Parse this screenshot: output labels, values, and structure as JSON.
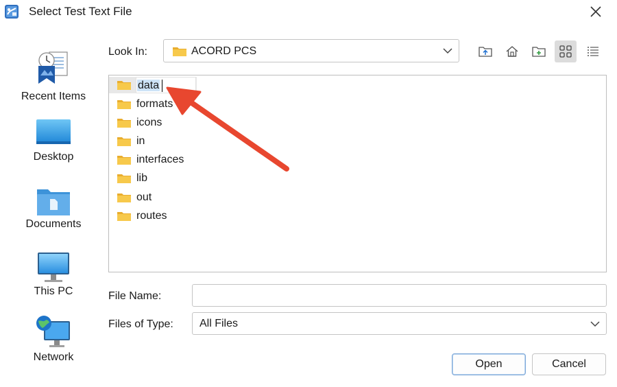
{
  "window": {
    "title": "Select Test Text File"
  },
  "colors": {
    "accent": "#1f6fd0",
    "selection": "#cde3f7",
    "folder": "#f5c342",
    "arrow": "#e8472f"
  },
  "places": [
    {
      "label": "Recent Items",
      "icon": "recent-items-icon"
    },
    {
      "label": "Desktop",
      "icon": "desktop-icon"
    },
    {
      "label": "Documents",
      "icon": "documents-icon"
    },
    {
      "label": "This PC",
      "icon": "this-pc-icon"
    },
    {
      "label": "Network",
      "icon": "network-icon"
    }
  ],
  "lookin": {
    "label": "Look In:",
    "value": "ACORD PCS"
  },
  "toolbar": [
    {
      "name": "up-one-level",
      "icon": "folder-up-icon"
    },
    {
      "name": "home",
      "icon": "home-icon"
    },
    {
      "name": "new-folder",
      "icon": "new-folder-icon"
    },
    {
      "name": "list-view",
      "icon": "grid-view-icon",
      "active": true
    },
    {
      "name": "details-view",
      "icon": "details-view-icon"
    }
  ],
  "files": [
    {
      "name": "data",
      "selected": true,
      "editing": true
    },
    {
      "name": "formats"
    },
    {
      "name": "icons"
    },
    {
      "name": "in"
    },
    {
      "name": "interfaces"
    },
    {
      "name": "lib"
    },
    {
      "name": "out"
    },
    {
      "name": "routes"
    }
  ],
  "filename": {
    "label": "File Name:",
    "value": "",
    "placeholder": ""
  },
  "filetype": {
    "label": "Files of Type:",
    "value": "All Files"
  },
  "buttons": {
    "open": "Open",
    "cancel": "Cancel"
  }
}
